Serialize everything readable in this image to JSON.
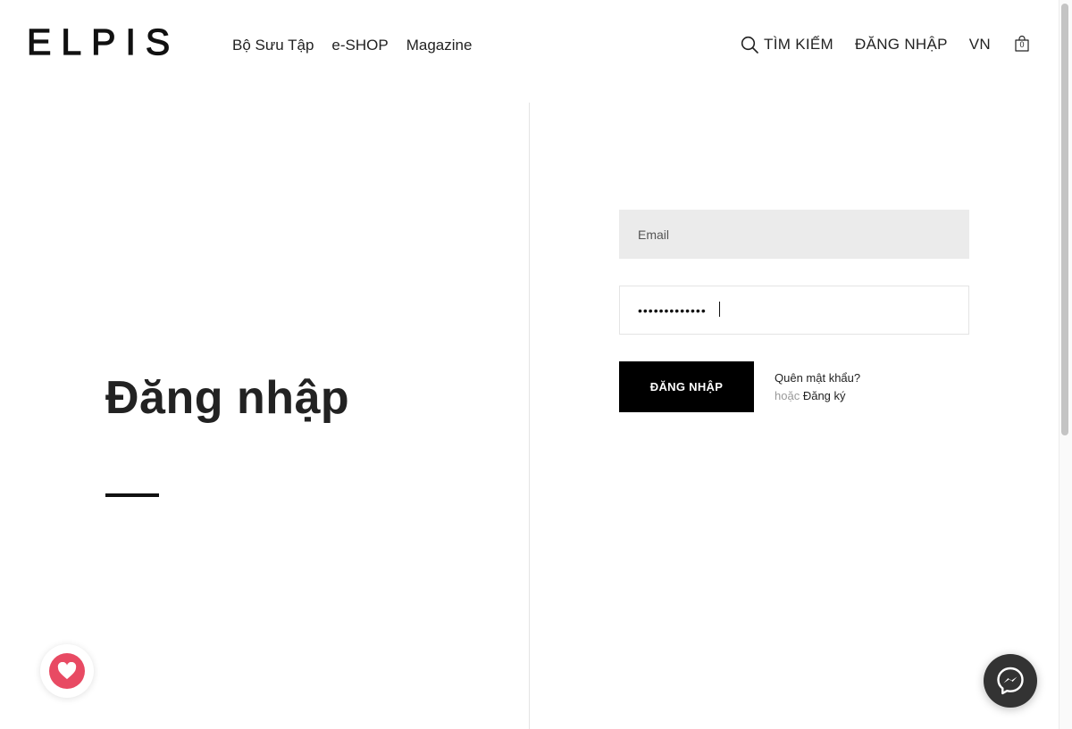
{
  "brand": {
    "logo_text": "ELPIS"
  },
  "main_nav": [
    {
      "label": "Bộ Sưu Tập"
    },
    {
      "label": "e-SHOP"
    },
    {
      "label": "Magazine"
    }
  ],
  "util_nav": {
    "search_label": "TÌM KIẾM",
    "login_label": "ĐĂNG NHẬP",
    "language": "VN",
    "cart_count": "0"
  },
  "page": {
    "title": "Đăng nhập"
  },
  "form": {
    "email_placeholder": "Email",
    "email_value": "",
    "password_value": "•••••••••••••",
    "submit_label": "ĐĂNG NHẬP",
    "forgot_label": "Quên mật khẩu?",
    "or_label": "hoặc",
    "register_label": "Đăng ký"
  },
  "colors": {
    "accent": "#000000",
    "wishlist": "#e84a63",
    "messenger_bg": "#333333",
    "input_bg": "#ebebeb"
  },
  "icons": {
    "search": "search-icon",
    "cart": "shopping-bag-icon",
    "wishlist": "heart-icon",
    "messenger": "messenger-icon"
  }
}
